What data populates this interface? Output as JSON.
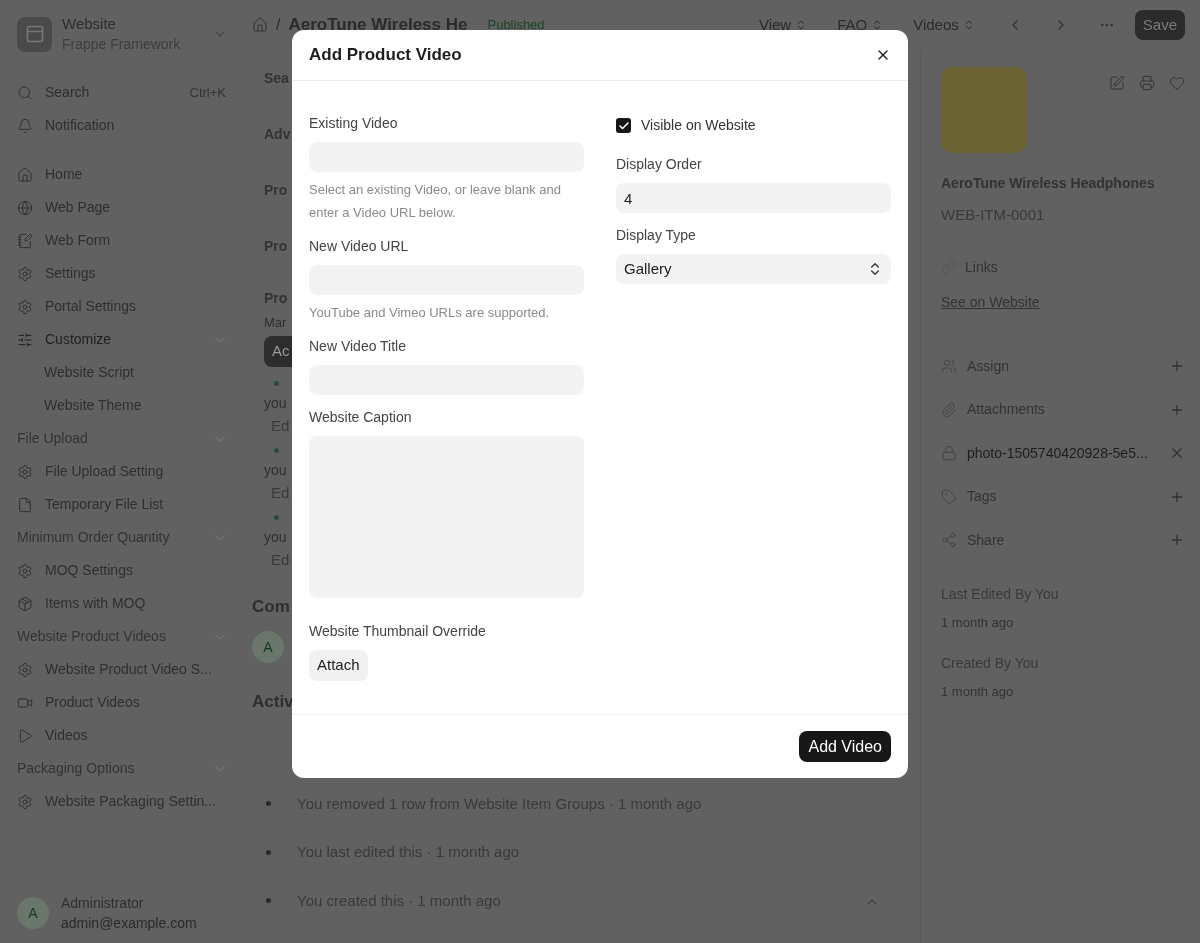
{
  "sidebar": {
    "app": {
      "title": "Website",
      "subtitle": "Frappe Framework"
    },
    "search": {
      "label": "Search",
      "shortcut": "Ctrl+K"
    },
    "notification": {
      "label": "Notification"
    },
    "items": [
      {
        "kind": "item",
        "label": "Home"
      },
      {
        "kind": "item",
        "label": "Web Page"
      },
      {
        "kind": "item",
        "label": "Web Form"
      },
      {
        "kind": "item",
        "label": "Settings"
      },
      {
        "kind": "item",
        "label": "Portal Settings"
      },
      {
        "kind": "group",
        "label": "Customize"
      },
      {
        "kind": "subitem",
        "label": "Website Script"
      },
      {
        "kind": "subitem",
        "label": "Website Theme"
      },
      {
        "kind": "section",
        "label": "File Upload"
      },
      {
        "kind": "item",
        "label": "File Upload Setting"
      },
      {
        "kind": "item",
        "label": "Temporary File List"
      },
      {
        "kind": "section",
        "label": "Minimum Order Quantity"
      },
      {
        "kind": "item",
        "label": "MOQ Settings"
      },
      {
        "kind": "item",
        "label": "Items with MOQ"
      },
      {
        "kind": "section",
        "label": "Website Product Videos"
      },
      {
        "kind": "item",
        "label": "Website Product Video S..."
      },
      {
        "kind": "item",
        "label": "Product Videos"
      },
      {
        "kind": "item",
        "label": "Videos"
      },
      {
        "kind": "section",
        "label": "Packaging Options"
      },
      {
        "kind": "item",
        "label": "Website Packaging Settin..."
      }
    ],
    "user": {
      "avatar": "A",
      "name": "Administrator",
      "email": "admin@example.com"
    }
  },
  "topbar": {
    "separator": "/",
    "title": "AeroTune Wireless He",
    "status": "Published",
    "dropdowns": [
      "View",
      "FAQ",
      "Videos"
    ],
    "save": "Save"
  },
  "behind_modal": [
    {
      "kind": "label",
      "text": "Sea"
    },
    {
      "kind": "label",
      "text": "Adv"
    },
    {
      "kind": "label",
      "text": "Pro"
    },
    {
      "kind": "label",
      "text": "Pro"
    },
    {
      "kind": "title",
      "text": "Pro"
    },
    {
      "kind": "sub",
      "text": "Mar"
    },
    {
      "kind": "button",
      "text": "Ac"
    },
    {
      "kind": "note",
      "text": "you"
    },
    {
      "kind": "edit",
      "text": "Ed"
    },
    {
      "kind": "note",
      "text": "you"
    },
    {
      "kind": "edit",
      "text": "Ed"
    },
    {
      "kind": "note",
      "text": "you"
    },
    {
      "kind": "edit",
      "text": "Ed"
    },
    {
      "kind": "heading",
      "text": "Com"
    },
    {
      "kind": "avatar",
      "text": "A"
    },
    {
      "kind": "heading",
      "text": "Activ"
    }
  ],
  "activity": [
    "You removed 1 row from Website Item Groups · 1 month ago",
    "You last edited this · 1 month ago",
    "You created this · 1 month ago"
  ],
  "right_panel": {
    "title": "AeroTune Wireless Headphones",
    "id": "WEB-ITM-0001",
    "links_label": "Links",
    "link": "See on Website",
    "sections": [
      {
        "kind": "assign",
        "label": "Assign"
      },
      {
        "kind": "attachments",
        "label": "Attachments"
      },
      {
        "kind": "file",
        "label": "photo-1505740420928-5e5..."
      },
      {
        "kind": "tags",
        "label": "Tags"
      },
      {
        "kind": "share",
        "label": "Share"
      }
    ],
    "meta": [
      {
        "label": "Last Edited By You",
        "time": "1 month ago"
      },
      {
        "label": "Created By You",
        "time": "1 month ago"
      }
    ]
  },
  "dialog": {
    "title": "Add Product Video",
    "left": [
      {
        "kind": "input",
        "label": "Existing Video",
        "description": "Select an existing Video, or leave blank and enter a Video URL below."
      },
      {
        "kind": "input",
        "label": "New Video URL",
        "description": "YouTube and Vimeo URLs are supported."
      },
      {
        "kind": "input",
        "label": "New Video Title"
      },
      {
        "kind": "textarea",
        "label": "Website Caption"
      },
      {
        "kind": "attach",
        "label": "Website Thumbnail Override",
        "button": "Attach"
      }
    ],
    "right": [
      {
        "kind": "checkbox",
        "label": "Visible on Website",
        "checked": true
      },
      {
        "kind": "input",
        "label": "Display Order",
        "value": "4"
      },
      {
        "kind": "select",
        "label": "Display Type",
        "value": "Gallery"
      }
    ],
    "primary": "Add Video"
  }
}
